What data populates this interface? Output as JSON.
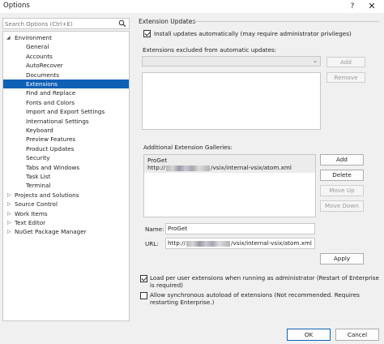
{
  "window": {
    "title": "Options",
    "help_glyph": "?",
    "close_glyph": "✕"
  },
  "search": {
    "placeholder": "Search Options (Ctrl+E)"
  },
  "tree": {
    "environment_label": "Environment",
    "environment_children": [
      "General",
      "Accounts",
      "AutoRecover",
      "Documents",
      "Extensions",
      "Find and Replace",
      "Fonts and Colors",
      "Import and Export Settings",
      "International Settings",
      "Keyboard",
      "Preview Features",
      "Product Updates",
      "Security",
      "Tabs and Windows",
      "Task List",
      "Terminal"
    ],
    "selected": "Extensions",
    "other_nodes": [
      "Projects and Solutions",
      "Source Control",
      "Work Items",
      "Text Editor",
      "NuGet Package Manager"
    ]
  },
  "extension_updates": {
    "section_title": "Extension Updates",
    "auto_install_label": "Install updates automatically (may require administrator privileges)",
    "auto_install_checked": true,
    "excluded_label": "Extensions excluded from automatic updates:",
    "add_label": "Add",
    "remove_label": "Remove"
  },
  "galleries": {
    "label": "Additional Extension Galleries:",
    "entry_name": "ProGet",
    "entry_url_prefix": "http://",
    "entry_url_suffix": "/vsix/internal-vsix/atom.xml",
    "add_label": "Add",
    "delete_label": "Delete",
    "move_up_label": "Move Up",
    "move_down_label": "Move Down",
    "name_label": "Name:",
    "name_value": "ProGet",
    "url_label": "URL:",
    "url_value_prefix": "http://",
    "url_value_suffix": "/vsix/internal-vsix/atom.xml",
    "apply_label": "Apply"
  },
  "options": {
    "per_user_label": "Load per user extensions when running as administrator (Restart of Enterprise is required)",
    "per_user_checked": true,
    "sync_autoload_label": "Allow synchronous autoload of extensions (Not recommended. Requires restarting Enterprise.)",
    "sync_autoload_checked": false
  },
  "footer": {
    "ok_label": "OK",
    "cancel_label": "Cancel"
  },
  "colors": {
    "selection": "#0e60b6",
    "background": "#f0f0f0"
  }
}
